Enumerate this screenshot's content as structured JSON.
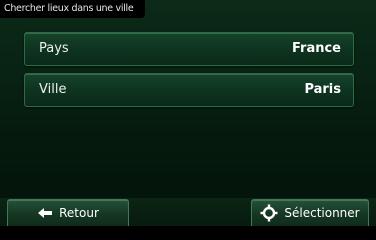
{
  "header": {
    "title": "Chercher lieux dans une ville"
  },
  "fields": [
    {
      "label": "Pays",
      "value": "France"
    },
    {
      "label": "Ville",
      "value": "Paris"
    }
  ],
  "buttons": {
    "back": {
      "label": "Retour",
      "icon": "arrow-left-icon"
    },
    "select": {
      "label": "Sélectionner",
      "icon": "crosshair-icon"
    }
  }
}
